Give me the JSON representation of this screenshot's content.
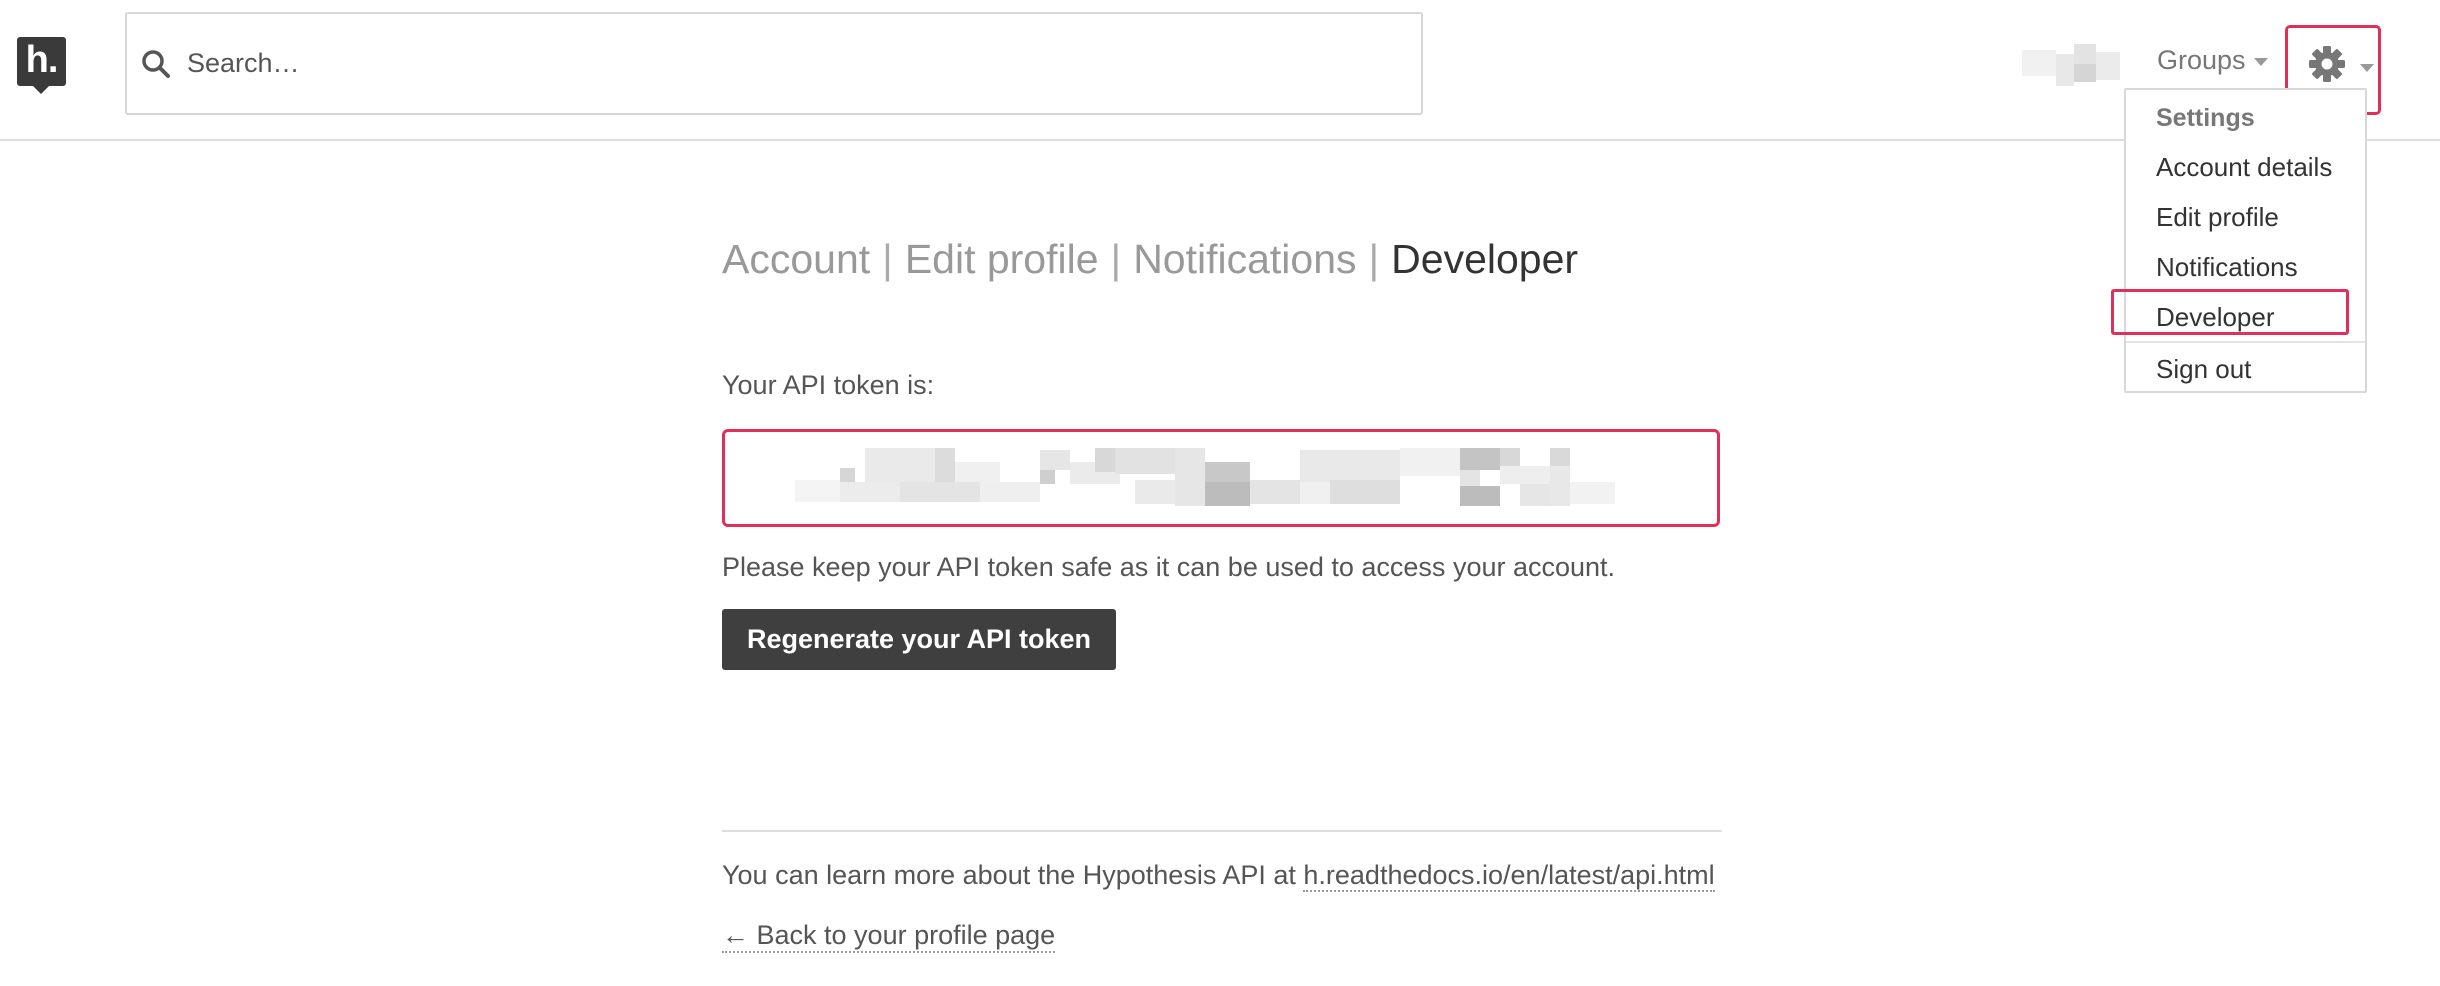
{
  "header": {
    "logo_text": "h.",
    "search": {
      "placeholder": "Search…",
      "value": ""
    },
    "groups_label": "Groups"
  },
  "settings_menu": {
    "heading": "Settings",
    "items": [
      {
        "label": "Account details"
      },
      {
        "label": "Edit profile"
      },
      {
        "label": "Notifications"
      },
      {
        "label": "Developer"
      },
      {
        "label": "Sign out"
      }
    ],
    "highlighted_item": "Developer"
  },
  "main": {
    "tabs": [
      {
        "label": "Account"
      },
      {
        "label": "Edit profile"
      },
      {
        "label": "Notifications"
      },
      {
        "label": "Developer",
        "active": true
      }
    ],
    "separator": "|",
    "token_label": "Your API token is:",
    "warning": "Please keep your API token safe as it can be used to access your account.",
    "regenerate_button": "Regenerate your API token",
    "learn_more_prefix": "You can learn more about the Hypothesis API at",
    "api_docs_link": "h.readthedocs.io/en/latest/api.html",
    "back_link": "← Back to your profile page"
  },
  "colors": {
    "highlight": "#e0305a",
    "button_bg": "#3f3f3f",
    "logo_bg": "#3a3a3a"
  }
}
